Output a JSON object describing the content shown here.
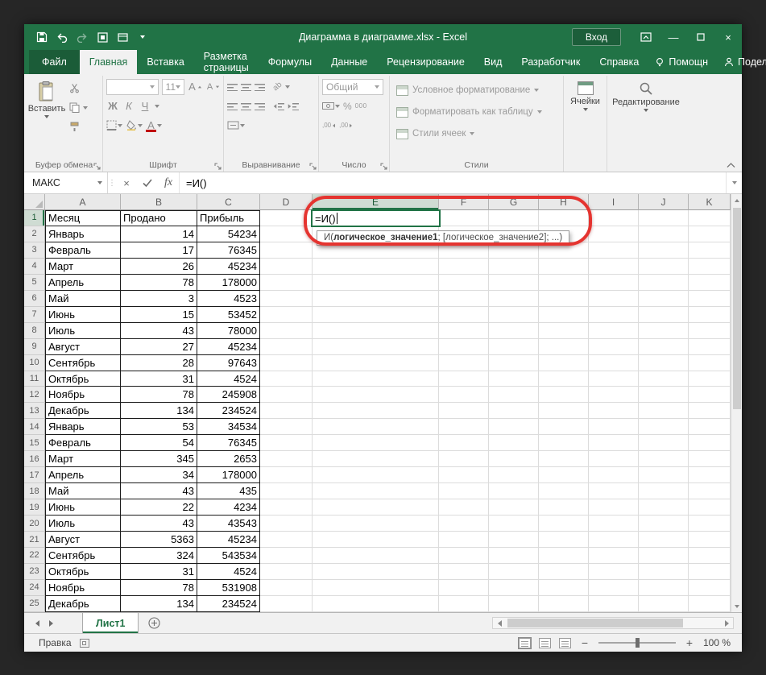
{
  "window": {
    "title": "Диаграмма в диаграмме.xlsx  -  Excel",
    "sign_in": "Вход"
  },
  "tabs": {
    "file": "Файл",
    "items": [
      "Главная",
      "Вставка",
      "Разметка страницы",
      "Формулы",
      "Данные",
      "Рецензирование",
      "Вид",
      "Разработчик",
      "Справка"
    ],
    "help": "Помощн",
    "share": "Поделиться"
  },
  "ribbon": {
    "clipboard": {
      "paste": "Вставить",
      "label": "Буфер обмена"
    },
    "font": {
      "label": "Шрифт",
      "size": "11",
      "bold": "Ж",
      "italic": "К",
      "underline": "Ч",
      "grow": "А",
      "shrink": "А",
      "color_letter": "А"
    },
    "alignment": {
      "label": "Выравнивание",
      "wrap": "ab"
    },
    "number": {
      "label": "Число",
      "format": "Общий",
      "thousands": "000",
      "percent": "%",
      "inc_decimal": ",00",
      "dec_decimal": ",00"
    },
    "styles": {
      "label": "Стили",
      "conditional": "Условное форматирование",
      "format_table": "Форматировать как таблицу",
      "cell_styles": "Стили ячеек"
    },
    "cells": {
      "label": "Ячейки"
    },
    "editing": {
      "label": "Редактирование"
    }
  },
  "formula_bar": {
    "name_box": "МАКС",
    "fx": "fx",
    "formula": "=И()"
  },
  "grid": {
    "columns": [
      "A",
      "B",
      "C",
      "D",
      "E",
      "F",
      "G",
      "H",
      "I",
      "J",
      "K"
    ],
    "active_column": "E",
    "active_row": 1,
    "edit_text": "=И()",
    "tooltip": {
      "prefix": "И(",
      "bold_arg": "логическое_значение1",
      "rest": "; [логическое_значение2]; ...)"
    },
    "rows": [
      [
        "Месяц",
        "Продано",
        "Прибыль"
      ],
      [
        "Январь",
        "14",
        "54234"
      ],
      [
        "Февраль",
        "17",
        "76345"
      ],
      [
        "Март",
        "26",
        "45234"
      ],
      [
        "Апрель",
        "78",
        "178000"
      ],
      [
        "Май",
        "3",
        "4523"
      ],
      [
        "Июнь",
        "15",
        "53452"
      ],
      [
        "Июль",
        "43",
        "78000"
      ],
      [
        "Август",
        "27",
        "45234"
      ],
      [
        "Сентябрь",
        "28",
        "97643"
      ],
      [
        "Октябрь",
        "31",
        "4524"
      ],
      [
        "Ноябрь",
        "78",
        "245908"
      ],
      [
        "Декабрь",
        "134",
        "234524"
      ],
      [
        "Январь",
        "53",
        "34534"
      ],
      [
        "Февраль",
        "54",
        "76345"
      ],
      [
        "Март",
        "345",
        "2653"
      ],
      [
        "Апрель",
        "34",
        "178000"
      ],
      [
        "Май",
        "43",
        "435"
      ],
      [
        "Июнь",
        "22",
        "4234"
      ],
      [
        "Июль",
        "43",
        "43543"
      ],
      [
        "Август",
        "5363",
        "45234"
      ],
      [
        "Сентябрь",
        "324",
        "543534"
      ],
      [
        "Октябрь",
        "31",
        "4524"
      ],
      [
        "Ноябрь",
        "78",
        "531908"
      ],
      [
        "Декабрь",
        "134",
        "234524"
      ]
    ]
  },
  "sheet_bar": {
    "sheet": "Лист1"
  },
  "status_bar": {
    "mode": "Правка",
    "zoom": "100 %"
  },
  "colors": {
    "excel_green": "#217346",
    "annotation_red": "#e53430"
  }
}
